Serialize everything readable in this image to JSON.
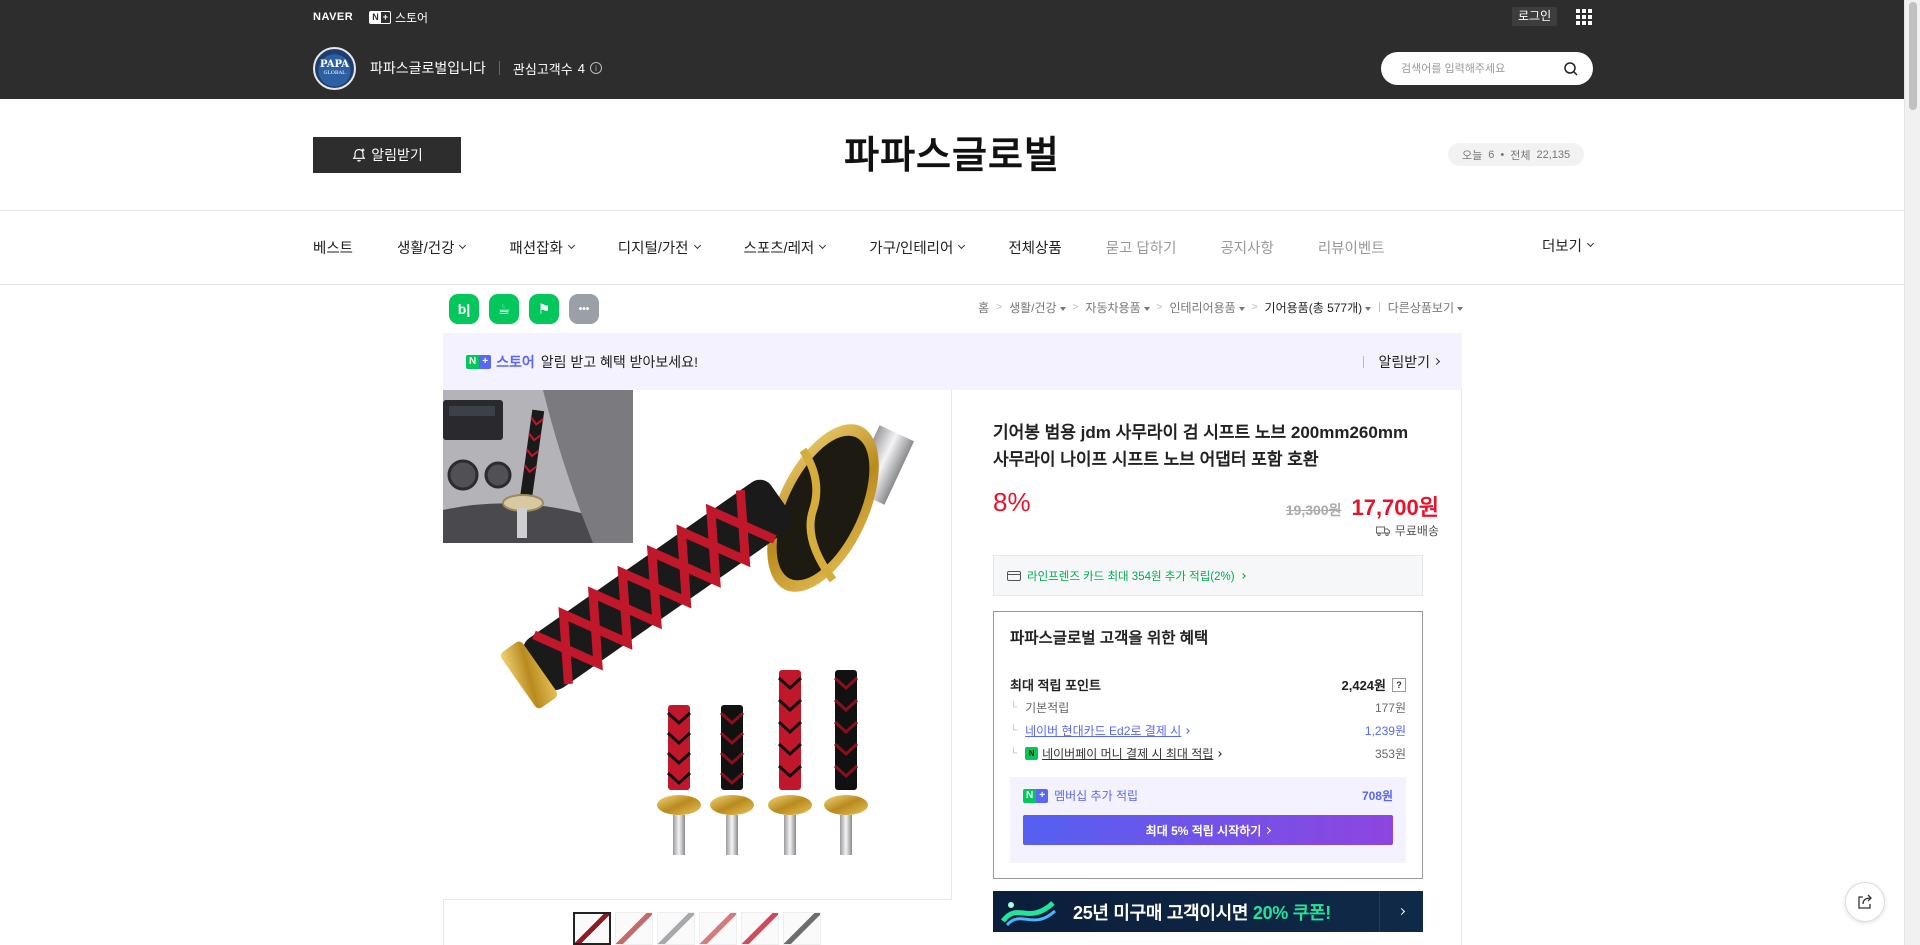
{
  "topbar": {
    "naver_logo": "NAVER",
    "nplus_n": "N",
    "nplus_plus": "+",
    "nplus_store": "스토어",
    "login": "로그인",
    "store_logo_text1": "PAPA",
    "store_logo_text2": "GLOBAL",
    "store_name": "파파스글로벌입니다",
    "interest_label": "관심고객수",
    "interest_count": "4",
    "search_placeholder": "검색어를 입력해주세요",
    "bg_color": "#2d2d2d"
  },
  "store_header": {
    "alarm_button": "알림받기",
    "title": "파파스글로벌",
    "visits_today_label": "오늘",
    "visits_today": "6",
    "visits_total_label": "전체",
    "visits_total": "22,135"
  },
  "nav": {
    "items": [
      {
        "label": "베스트",
        "dropdown": false,
        "muted": false
      },
      {
        "label": "생활/건강",
        "dropdown": true,
        "muted": false
      },
      {
        "label": "패션잡화",
        "dropdown": true,
        "muted": false
      },
      {
        "label": "디지털/가전",
        "dropdown": true,
        "muted": false
      },
      {
        "label": "스포츠/레저",
        "dropdown": true,
        "muted": false
      },
      {
        "label": "가구/인테리어",
        "dropdown": true,
        "muted": false
      },
      {
        "label": "전체상품",
        "dropdown": false,
        "muted": false
      },
      {
        "label": "묻고 답하기",
        "dropdown": false,
        "muted": true
      },
      {
        "label": "공지사항",
        "dropdown": false,
        "muted": true
      },
      {
        "label": "리뷰이벤트",
        "dropdown": false,
        "muted": true
      }
    ],
    "more": "더보기"
  },
  "quick_icons": [
    {
      "icon": "blog-icon",
      "glyph": "b|"
    },
    {
      "icon": "cafe-icon",
      "glyph": "☕"
    },
    {
      "icon": "bookmark-icon",
      "glyph": "⚑"
    },
    {
      "icon": "more-icon",
      "glyph": "•••"
    }
  ],
  "breadcrumb": {
    "home": "홈",
    "items": [
      "생활/건강",
      "자동차용품",
      "인테리어용품"
    ],
    "current": "기어용품(총 577개)",
    "other": "다른상품보기"
  },
  "notice": {
    "badge_n": "N",
    "badge_plus": "+",
    "store_word": "스토어",
    "text": "알림 받고 혜택 받아보세요!",
    "alarm": "알림받기",
    "bg_color": "#f4f2fe",
    "accent": "#5867f5"
  },
  "product": {
    "title": "기어봉 범용 jdm 사무라이 검 시프트 노브 200mm260mm 사무라이 나이프 시프트 노브 어댑터 포함 호환",
    "discount": "8%",
    "original_price": "19,300원",
    "sale_price": "17,700원",
    "shipping": "무료배송",
    "card_benefit": "라인프렌즈 카드 최대 354원 추가 적립(2%)",
    "price_color": "#e5142c",
    "thumb_count": 6
  },
  "benefits": {
    "title": "파파스글로벌 고객을 위한 혜택",
    "max_points_label": "최대 적립 포인트",
    "max_points": "2,424원",
    "help": "?",
    "rows": [
      {
        "label": "기본적립",
        "value": "177원",
        "style": "plain"
      },
      {
        "label": "네이버 현대카드 Ed2로 결제 시",
        "value": "1,239원",
        "style": "purple"
      },
      {
        "label": "네이버페이 머니 결제 시 최대 적립",
        "value": "353원",
        "style": "npay"
      }
    ],
    "membership_label": "멤버십 추가 적립",
    "membership_value": "708원",
    "membership_button": "최대 5% 적립 시작하기"
  },
  "coupon": {
    "text_pre": "25년 미구매 고객이시면",
    "text_highlight": "20% 쿠폰!",
    "highlight_color": "#22e59a"
  }
}
